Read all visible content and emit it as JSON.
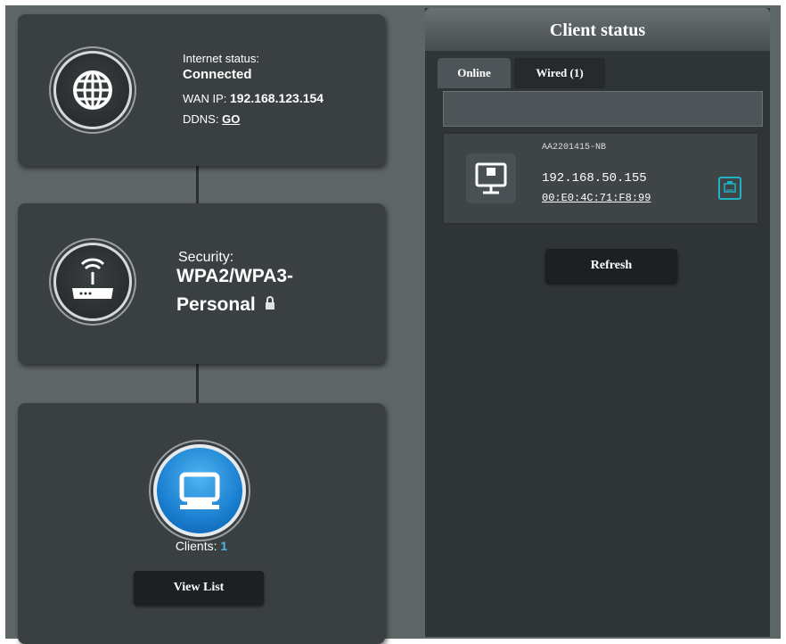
{
  "internet": {
    "status_label": "Internet status:",
    "status_value": "Connected",
    "wan_label": "WAN IP:",
    "wan_ip": "192.168.123.154",
    "ddns_label": "DDNS:",
    "ddns_link": "GO"
  },
  "security": {
    "label": "Security:",
    "value_line1": "WPA2/WPA3-",
    "value_line2": "Personal"
  },
  "clients": {
    "label": "Clients:",
    "count": "1",
    "view_list_button": "View List"
  },
  "client_status": {
    "title": "Client status",
    "tabs": [
      {
        "label": "Online",
        "active": true
      },
      {
        "label": "Wired (1)",
        "active": false
      }
    ],
    "device": {
      "name": "AA2201415-NB",
      "ip": "192.168.50.155",
      "mac": "00:E0:4C:71:F8:99",
      "connection_icon": "ethernet-icon"
    },
    "refresh_button": "Refresh"
  },
  "colors": {
    "background": "#5f6668",
    "card": "#3a3f41",
    "accent_blue": "#1a7fd0",
    "wired_icon": "#1fb3c4",
    "clients_count": "#4db2e8"
  }
}
